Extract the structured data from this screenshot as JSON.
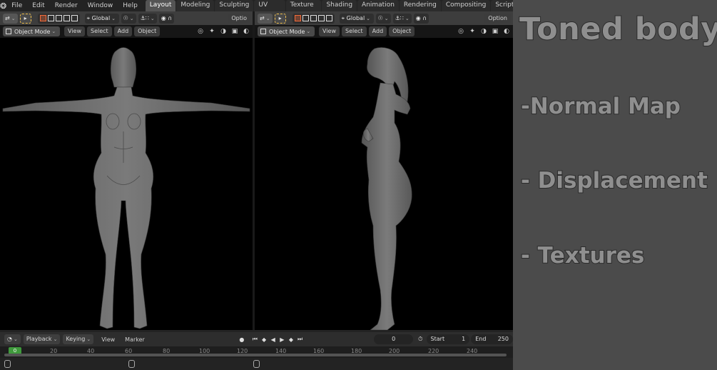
{
  "menu": [
    "File",
    "Edit",
    "Render",
    "Window",
    "Help"
  ],
  "workspace_tabs": [
    {
      "label": "Layout",
      "active": true
    },
    {
      "label": "Modeling",
      "active": false
    },
    {
      "label": "Sculpting",
      "active": false
    },
    {
      "label": "UV Editing",
      "active": false
    },
    {
      "label": "Texture Paint",
      "active": false
    },
    {
      "label": "Shading",
      "active": false
    },
    {
      "label": "Animation",
      "active": false
    },
    {
      "label": "Rendering",
      "active": false
    },
    {
      "label": "Compositing",
      "active": false
    },
    {
      "label": "Scripting",
      "active": false
    }
  ],
  "add_workspace_label": "+",
  "viewport_left": {
    "orientation": "Global",
    "options_label": "Optio",
    "mode": "Object Mode",
    "menus": [
      "View",
      "Select",
      "Add",
      "Object"
    ]
  },
  "viewport_right": {
    "orientation": "Global",
    "options_label": "Option",
    "mode": "Object Mode",
    "menus": [
      "View",
      "Select",
      "Add",
      "Object"
    ]
  },
  "timeline": {
    "menus": [
      "Playback",
      "Keying"
    ],
    "text_menus": [
      "View",
      "Marker"
    ],
    "current_frame": "0",
    "start_label": "Start",
    "start_value": "1",
    "end_label": "End",
    "end_value": "250",
    "ruler_ticks": [
      "0",
      "20",
      "40",
      "60",
      "80",
      "100",
      "120",
      "140",
      "160",
      "180",
      "200",
      "220",
      "240"
    ],
    "cursor_frame": "0"
  },
  "panel": {
    "title": "Toned body",
    "lines": [
      "-Normal Map",
      "- Displacement",
      "- Textures"
    ]
  },
  "colors": {
    "accent_active_tab": "#545454",
    "selected_tool": "#4772b3",
    "playhead": "#3f9a3c",
    "panel_bg": "#4b4b4b",
    "panel_text": "#8f8f8f"
  },
  "icons": [
    "blender-logo-icon",
    "select-box-icon",
    "snap-icon",
    "proportional-edit-icon",
    "play-icon",
    "stopwatch-icon"
  ]
}
